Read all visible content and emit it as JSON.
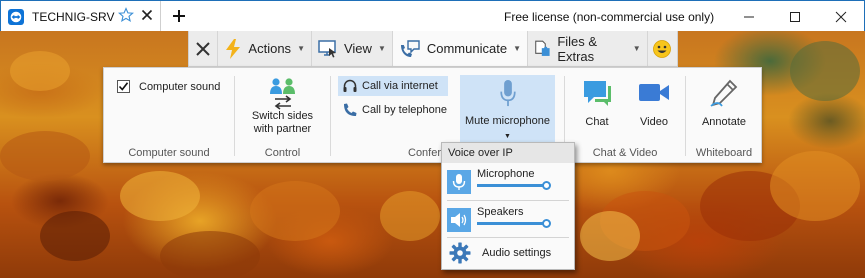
{
  "titlebar": {
    "tab_title": "TECHNIG-SRV",
    "license_text": "Free license (non-commercial use only)",
    "icons": [
      "teamviewer-logo-icon",
      "favorite-star-icon",
      "tab-close-icon",
      "new-tab-icon",
      "minimize-icon",
      "maximize-icon",
      "window-close-icon"
    ]
  },
  "toolbar": {
    "actions_label": "Actions",
    "view_label": "View",
    "communicate_label": "Communicate",
    "files_label": "Files & Extras",
    "active_tab": "Communicate"
  },
  "ribbon": {
    "computer_sound": {
      "checkbox_label": "Computer sound",
      "checked": true,
      "group_label": "Computer sound"
    },
    "control": {
      "switch_label_line1": "Switch sides",
      "switch_label_line2": "with partner",
      "group_label": "Control"
    },
    "conference": {
      "call_internet_label": "Call via internet",
      "call_phone_label": "Call by telephone",
      "mute_label": "Mute microphone",
      "group_label_partial": "Confer"
    },
    "chat_video": {
      "chat_label": "Chat",
      "video_label": "Video",
      "group_label": "Chat & Video"
    },
    "whiteboard": {
      "annotate_label": "Annotate",
      "group_label": "Whiteboard"
    }
  },
  "voip_dropdown": {
    "header": "Voice over IP",
    "microphone_label": "Microphone",
    "microphone_level": 1.0,
    "speakers_label": "Speakers",
    "speakers_level": 1.0,
    "audio_settings_label": "Audio settings"
  },
  "colors": {
    "accent_blue": "#3b8fd6",
    "highlight_blue": "#cfe3f7",
    "toolbar_bg": "#ececec"
  }
}
